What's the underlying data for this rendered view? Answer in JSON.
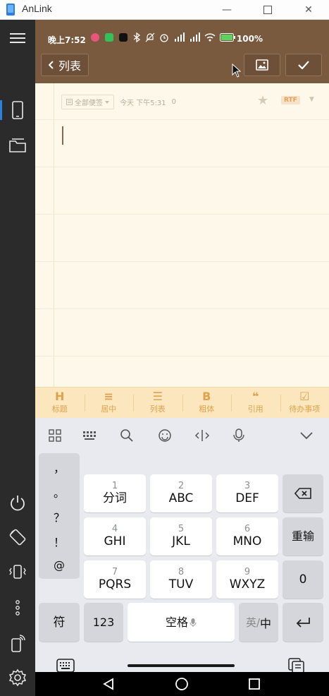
{
  "window": {
    "title": "AnLink",
    "controls": {
      "minimize": "—",
      "maximize": "☐",
      "close": "✕"
    }
  },
  "sidedock": {
    "top_icons": [
      "menu-icon",
      "phone-icon",
      "folder-icon"
    ],
    "bottom_icons": [
      "power-icon",
      "rotate-icon",
      "vibrate-icon",
      "more-icon",
      "cast-icon",
      "settings-icon"
    ],
    "accent": "#2b7fe0"
  },
  "status_bar": {
    "time": "晚上7:52",
    "battery": "100%",
    "background": "#7a5a3f"
  },
  "app_bar": {
    "back_label": "列表",
    "image_button_icon": "image-icon",
    "confirm_button_icon": "check-icon"
  },
  "note": {
    "category": "全部便签",
    "timestamp": "今天 下午5:31",
    "char_count": "0",
    "format_badge": "RTF"
  },
  "format_toolbar": {
    "items": [
      {
        "glyph": "H",
        "label": "标题"
      },
      {
        "glyph": "≡",
        "label": "居中"
      },
      {
        "glyph": "☰",
        "label": "列表"
      },
      {
        "glyph": "B",
        "label": "粗体"
      },
      {
        "glyph": "❝",
        "label": "引用"
      },
      {
        "glyph": "☑",
        "label": "待办事项"
      }
    ],
    "accent": "#e0a24f"
  },
  "keyboard": {
    "punctuation": [
      "，",
      "。",
      "？",
      "！",
      "@"
    ],
    "rows": [
      [
        {
          "num": "1",
          "main": "分词"
        },
        {
          "num": "2",
          "main": "ABC"
        },
        {
          "num": "3",
          "main": "DEF"
        }
      ],
      [
        {
          "num": "4",
          "main": "GHI"
        },
        {
          "num": "5",
          "main": "JKL"
        },
        {
          "num": "6",
          "main": "MNO"
        }
      ],
      [
        {
          "num": "7",
          "main": "PQRS"
        },
        {
          "num": "8",
          "main": "TUV"
        },
        {
          "num": "9",
          "main": "WXYZ"
        }
      ]
    ],
    "right_keys": {
      "retype": "重输",
      "zero": "0"
    },
    "bottom_row": {
      "symbols": "符",
      "numbers": "123",
      "space": "空格",
      "lang_en": "英/",
      "lang_zh": "中"
    }
  }
}
